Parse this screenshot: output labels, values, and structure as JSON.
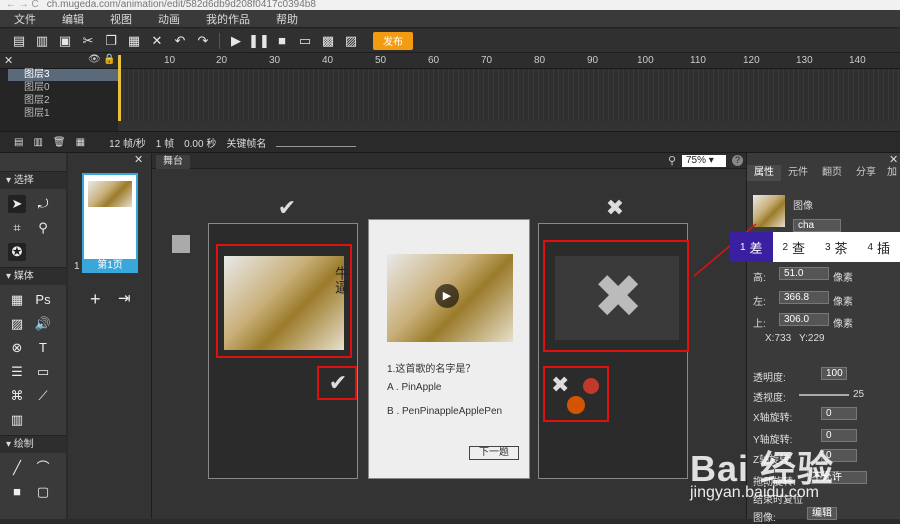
{
  "browser": {
    "url": "ch.mugeda.com/animation/edit/582d6db9d208f0417c0394b8"
  },
  "menu": [
    "文件",
    "编辑",
    "视图",
    "动画",
    "我的作品",
    "帮助"
  ],
  "toolbar": {
    "publish_label": "发布"
  },
  "timeline": {
    "layers": [
      {
        "label": "图层3",
        "selected": true
      },
      {
        "label": "图层0"
      },
      {
        "label": "图层2"
      },
      {
        "label": "图层1"
      }
    ],
    "ruler": [
      "10",
      "20",
      "30",
      "40",
      "50",
      "60",
      "70",
      "80",
      "90",
      "100",
      "110",
      "120",
      "130",
      "140"
    ],
    "fps": "12 帧/秒",
    "frame": "1 帧",
    "time": "0.00 秒",
    "keyframe_label": "关键帧名"
  },
  "left_panel": {
    "sections": {
      "select": "选择",
      "media": "媒体",
      "draw": "绘制"
    }
  },
  "pages": {
    "page_num": "1",
    "page_label": "第1页"
  },
  "stage": {
    "tab": "舞台",
    "zoom": "75%",
    "question": "1.这首歌的名字是？",
    "option_a": "A . PinApple",
    "option_b": "B . PenPinappleApplePen",
    "next": "下一题",
    "side_text": "牛逼"
  },
  "right_panel": {
    "tabs": [
      "属性",
      "元件",
      "翻页",
      "分享",
      "加"
    ],
    "type_label": "图像",
    "name": "cha",
    "height_label": "高:",
    "height_value": "51.0",
    "unit": "像素",
    "left_label": "左:",
    "left_value": "366.8",
    "top_label": "上:",
    "top_value": "306.0",
    "coord_x": "X:733",
    "coord_y": "Y:229",
    "opacity_label": "透明度:",
    "opacity_value": "100",
    "blur_label": "透视度:",
    "blur_value": "25",
    "xrot_label": "X轴旋转:",
    "xrot_value": "0",
    "yrot_label": "Y轴旋转:",
    "yrot_value": "0",
    "zrot_label": "Z轴旋转:",
    "zrot_value": "0",
    "drag_label": "拖动旋转:",
    "drag_value": "不允许",
    "reset_label": "结束时复位",
    "image_label": "图像:",
    "image_btn": "编辑"
  },
  "overlay_tabs": [
    {
      "num": "1",
      "label": "差"
    },
    {
      "num": "2",
      "label": "查"
    },
    {
      "num": "3",
      "label": "茶"
    },
    {
      "num": "4",
      "label": "插"
    }
  ],
  "watermark": {
    "brand": "Bai 经验",
    "url": "jingyan.baidu.com"
  }
}
